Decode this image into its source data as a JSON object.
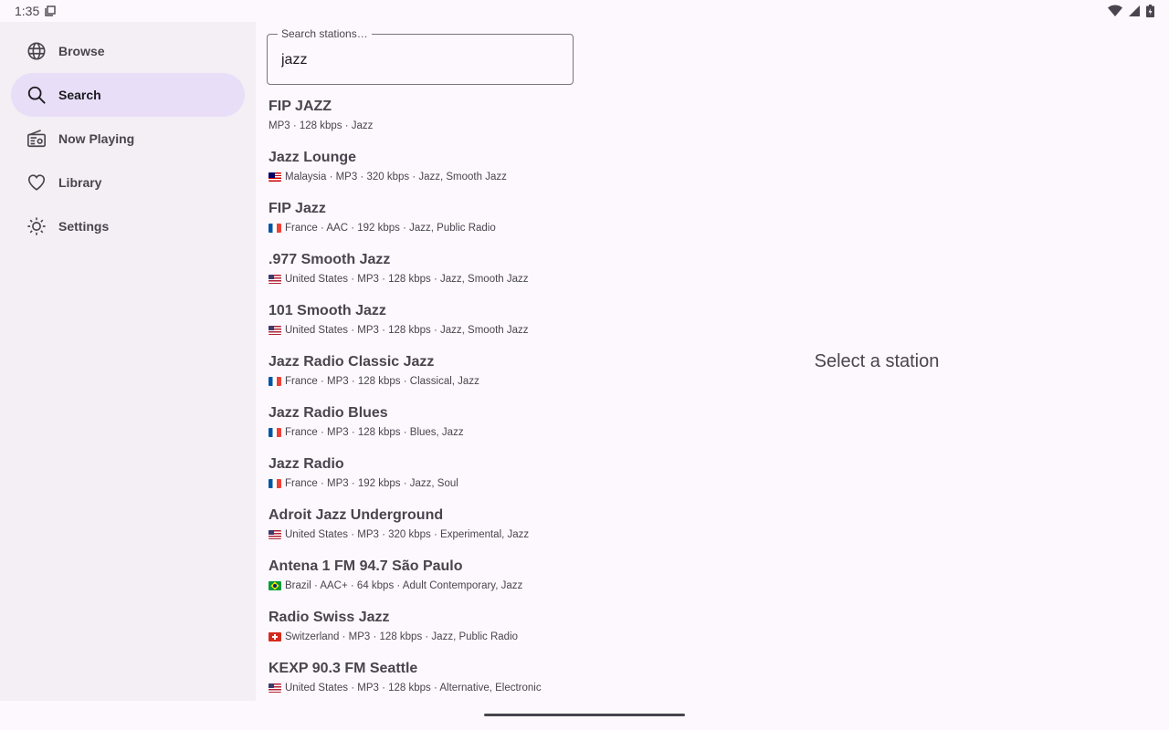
{
  "status_bar": {
    "time": "1:35"
  },
  "nav": {
    "items": [
      {
        "label": "Browse",
        "icon": "globe-icon",
        "active": false
      },
      {
        "label": "Search",
        "icon": "search-icon",
        "active": true
      },
      {
        "label": "Now Playing",
        "icon": "radio-icon",
        "active": false
      },
      {
        "label": "Library",
        "icon": "heart-icon",
        "active": false
      },
      {
        "label": "Settings",
        "icon": "settings-sun-icon",
        "active": false
      }
    ]
  },
  "search": {
    "label": "Search stations…",
    "value": "jazz"
  },
  "results": [
    {
      "name": "FIP JAZZ",
      "flag": "",
      "meta": "MP3 · 128 kbps · Jazz"
    },
    {
      "name": "Jazz Lounge",
      "flag": "my",
      "meta": "Malaysia · MP3 · 320 kbps · Jazz, Smooth Jazz"
    },
    {
      "name": "FIP Jazz",
      "flag": "fr",
      "meta": "France · AAC · 192 kbps · Jazz, Public Radio"
    },
    {
      "name": ".977 Smooth Jazz",
      "flag": "us",
      "meta": "United States · MP3 · 128 kbps · Jazz, Smooth Jazz"
    },
    {
      "name": "101 Smooth Jazz",
      "flag": "us",
      "meta": "United States · MP3 · 128 kbps · Jazz, Smooth Jazz"
    },
    {
      "name": "Jazz Radio Classic Jazz",
      "flag": "fr",
      "meta": "France · MP3 · 128 kbps · Classical, Jazz"
    },
    {
      "name": "Jazz Radio Blues",
      "flag": "fr",
      "meta": "France · MP3 · 128 kbps · Blues, Jazz"
    },
    {
      "name": "Jazz Radio",
      "flag": "fr",
      "meta": "France · MP3 · 192 kbps · Jazz, Soul"
    },
    {
      "name": "Adroit Jazz Underground",
      "flag": "us",
      "meta": "United States · MP3 · 320 kbps · Experimental, Jazz"
    },
    {
      "name": "Antena 1 FM 94.7 São Paulo",
      "flag": "br",
      "meta": "Brazil · AAC+ · 64 kbps · Adult Contemporary, Jazz"
    },
    {
      "name": "Radio Swiss Jazz",
      "flag": "ch",
      "meta": "Switzerland · MP3 · 128 kbps · Jazz, Public Radio"
    },
    {
      "name": "KEXP 90.3 FM Seattle",
      "flag": "us",
      "meta": "United States · MP3 · 128 kbps · Alternative, Electronic"
    }
  ],
  "detail": {
    "empty_text": "Select a station"
  },
  "colors": {
    "background": "#fdf8fd",
    "nav_background": "#f3eff4",
    "active_indicator": "#e8def8",
    "text_secondary": "#49454f"
  }
}
